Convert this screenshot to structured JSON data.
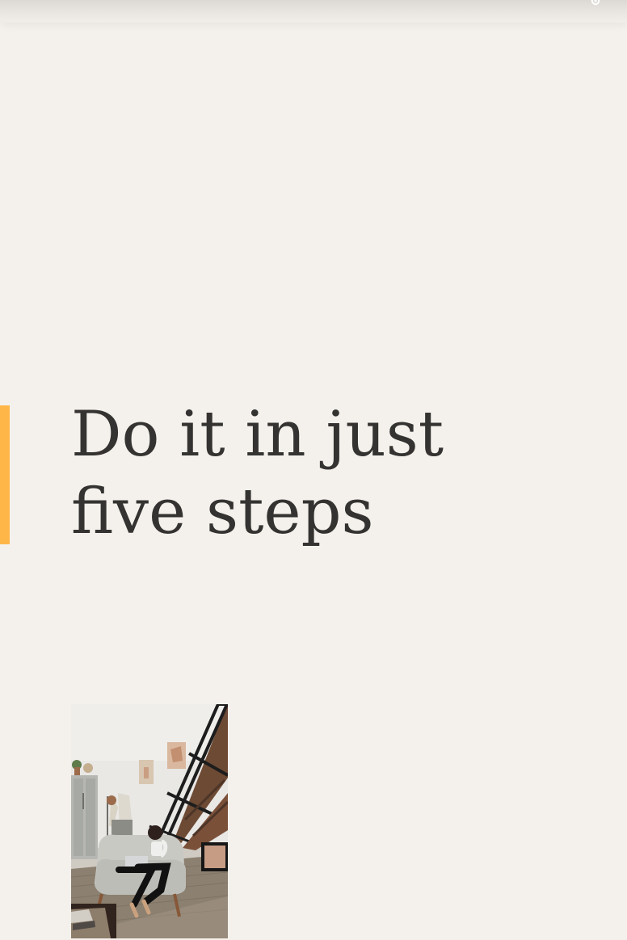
{
  "header": {
    "menu_icon": "settings-gear-icon"
  },
  "hero": {
    "title_line1": "Do it in just",
    "title_line2": "five steps",
    "accent_color": "#ffb649"
  },
  "photo": {
    "subject": "room-interior-photo"
  }
}
